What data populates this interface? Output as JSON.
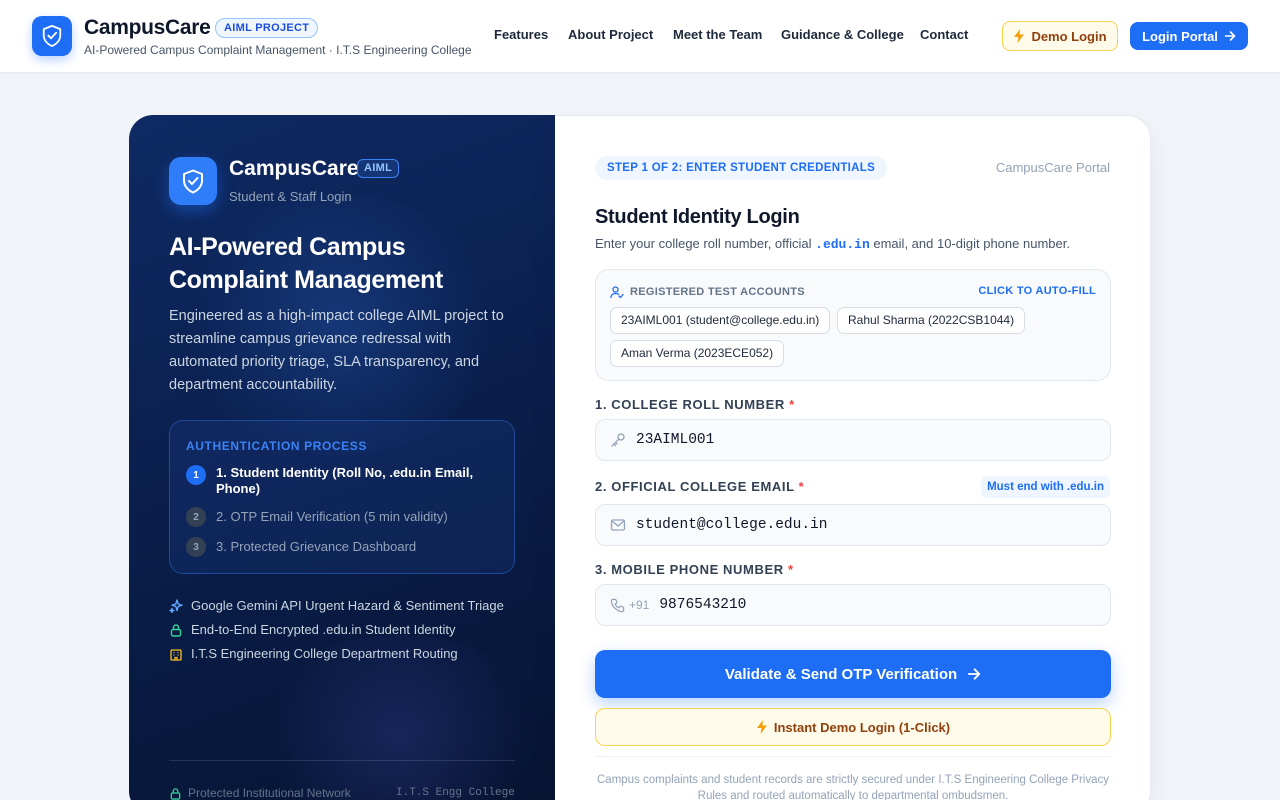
{
  "header": {
    "brand_name": "CampusCare",
    "brand_badge": "AIML PROJECT",
    "brand_subtitle": "AI-Powered Campus Complaint Management · I.T.S Engineering College",
    "nav": [
      "Features",
      "About Project",
      "Meet the Team",
      "Guidance & College",
      "Contact"
    ],
    "demo_login_label": "Demo Login",
    "login_portal_label": "Login Portal"
  },
  "left_panel": {
    "brand_name": "CampusCare",
    "brand_badge": "AIML",
    "brand_subtitle": "Student & Staff Login",
    "title": "AI-Powered Campus Complaint Management",
    "description": "Engineered as a high-impact college AIML project to streamline campus grievance redressal with automated priority triage, SLA transparency, and department accountability.",
    "auth_process": {
      "title": "AUTHENTICATION PROCESS",
      "steps": [
        {
          "number": "1",
          "label": "1. Student Identity (Roll No, .edu.in Email, Phone)",
          "active": true
        },
        {
          "number": "2",
          "label": "2. OTP Email Verification (5 min validity)",
          "active": false
        },
        {
          "number": "3",
          "label": "3. Protected Grievance Dashboard",
          "active": false
        }
      ]
    },
    "features": [
      {
        "icon": "sparkle-icon",
        "label": "Google Gemini API Urgent Hazard & Sentiment Triage"
      },
      {
        "icon": "lock-icon",
        "label": "End-to-End Encrypted .edu.in Student Identity"
      },
      {
        "icon": "building-icon",
        "label": "I.T.S Engineering College Department Routing"
      }
    ],
    "footer_left": "Protected Institutional Network",
    "footer_right": "I.T.S Engg College"
  },
  "form": {
    "step_label": "STEP 1 OF 2: ENTER STUDENT CREDENTIALS",
    "portal_tag": "CampusCare Portal",
    "title": "Student Identity Login",
    "subtitle_before": "Enter your college roll number, official ",
    "subtitle_code": ".edu.in",
    "subtitle_after": " email, and 10-digit phone number.",
    "test_accounts": {
      "heading": "REGISTERED TEST ACCOUNTS",
      "action": "CLICK TO AUTO-FILL",
      "accounts": [
        "23AIML001 (student@college.edu.in)",
        "Rahul Sharma (2022CSB1044)",
        "Aman Verma (2023ECE052)"
      ]
    },
    "roll_label": "1. COLLEGE ROLL NUMBER",
    "roll_value": "23AIML001",
    "email_label": "2. OFFICIAL COLLEGE EMAIL",
    "email_hint": "Must end with .edu.in",
    "email_value": "student@college.edu.in",
    "phone_label": "3. MOBILE PHONE NUMBER",
    "phone_prefix": "+91",
    "phone_value": "9876543210",
    "required_mark": "*",
    "validate_label": "Validate & Send OTP Verification",
    "instant_demo_label": "Instant Demo Login (1-Click)",
    "footer_note": "Campus complaints and student records are strictly secured under I.T.S Engineering College Privacy Rules and routed automatically to departmental ombudsmen."
  },
  "colors": {
    "primary": "#1d6ef5",
    "panel_dark": "#0a1f4e",
    "amber_bg": "#fffbeb",
    "amber_border": "#fcd34d",
    "amber_text": "#92400e",
    "required": "#ef4444"
  }
}
